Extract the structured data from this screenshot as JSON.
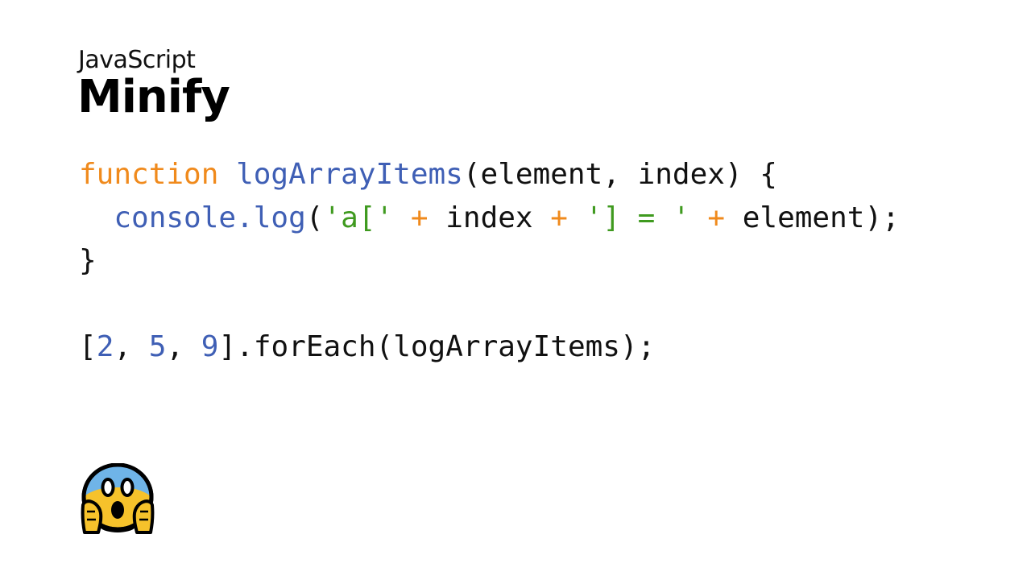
{
  "slide": {
    "subtitle": "JavaScript",
    "title": "Minify"
  },
  "code": {
    "line1": {
      "keyword": "function",
      "sp1": " ",
      "name": "logArrayItems",
      "rest": "(element, index) {"
    },
    "line2": {
      "indent": "  ",
      "call": "console.log",
      "p1": "(",
      "s1": "'a['",
      "sp1": " ",
      "op1": "+",
      "mid1": " index ",
      "op2": "+",
      "sp2": " ",
      "s2": "'] = '",
      "sp3": " ",
      "op3": "+",
      "rest": " element);"
    },
    "line3": {
      "text": "}"
    },
    "line4": {
      "text": ""
    },
    "line5": {
      "b1": "[",
      "n1": "2",
      "c1": ", ",
      "n2": "5",
      "c2": ", ",
      "n3": "9",
      "rest": "].forEach(logArrayItems);"
    }
  },
  "emoji": {
    "icon": "face-screaming-in-fear-icon"
  },
  "colors": {
    "keyword": "#f08a1c",
    "function": "#3f5fb5",
    "string": "#3f9a1f",
    "number": "#3f5fb5",
    "text": "#111111",
    "background": "#ffffff"
  }
}
